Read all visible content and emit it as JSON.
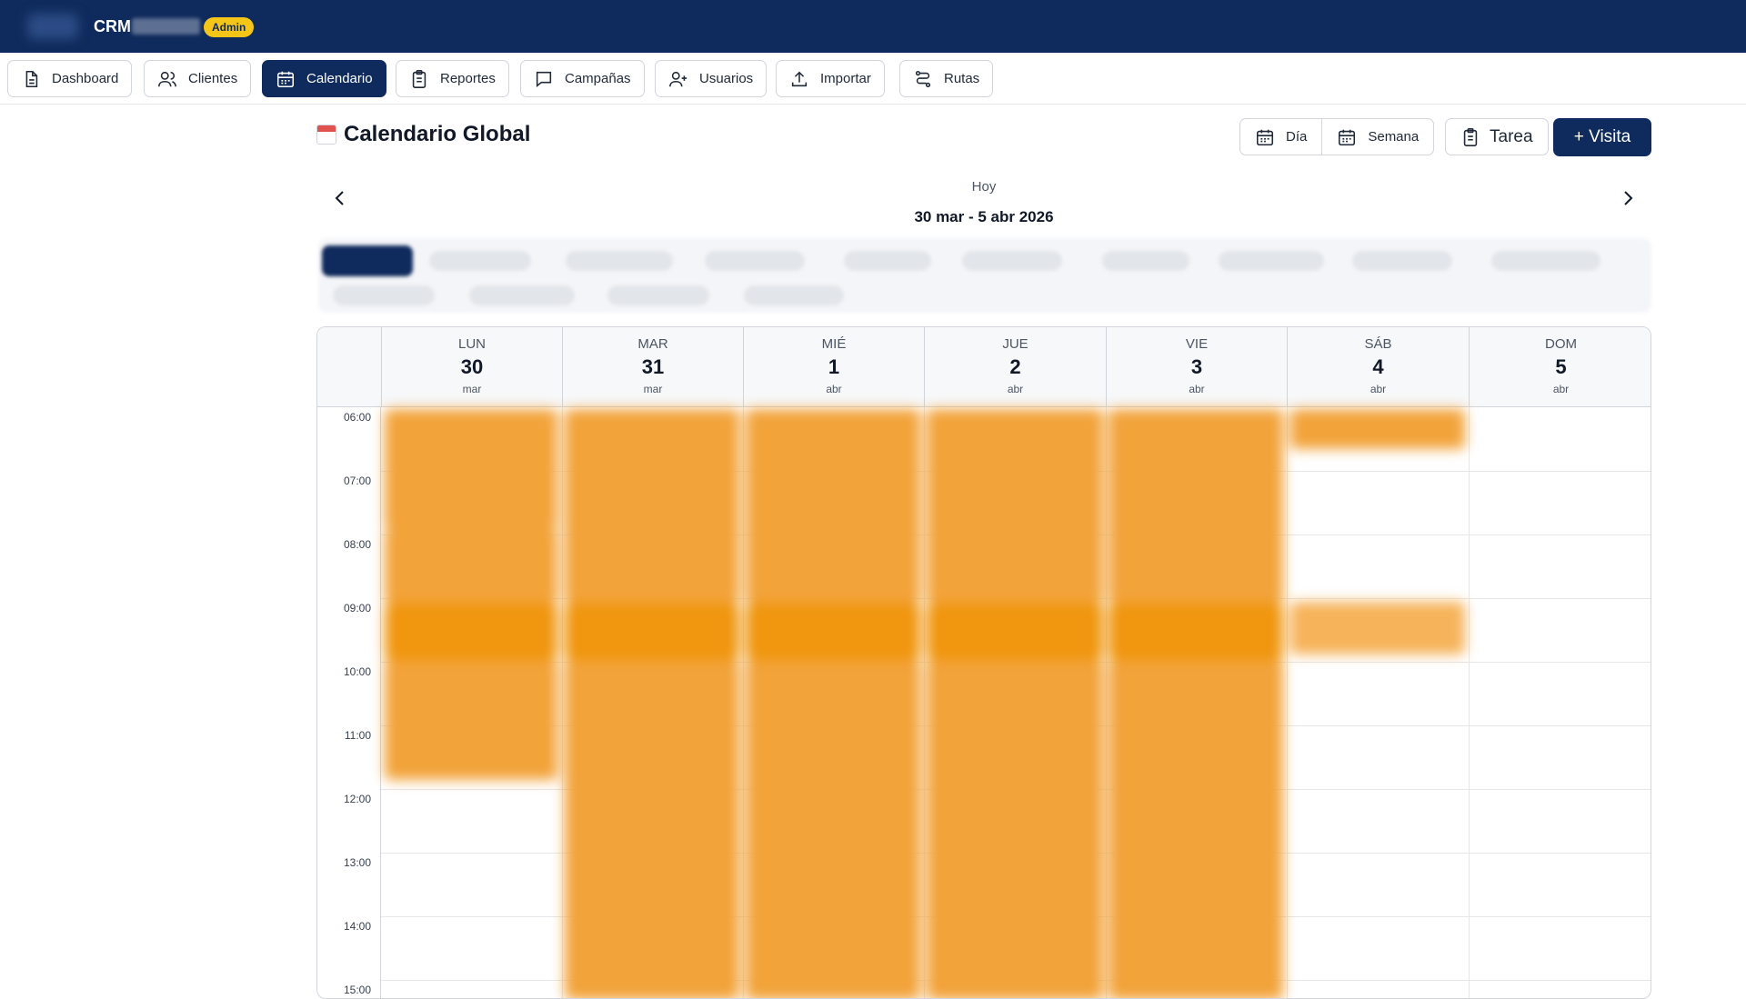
{
  "header": {
    "app_name": "CRM",
    "role_badge": "Admin",
    "colors": {
      "primary": "#0f2a5c",
      "badge": "#f5c518",
      "event": "#f2a33a"
    }
  },
  "nav": {
    "tabs": [
      {
        "label": "Dashboard",
        "icon": "document-icon",
        "active": false
      },
      {
        "label": "Clientes",
        "icon": "users-icon",
        "active": false
      },
      {
        "label": "Calendario",
        "icon": "calendar-icon",
        "active": true
      },
      {
        "label": "Reportes",
        "icon": "clipboard-icon",
        "active": false
      },
      {
        "label": "Campañas",
        "icon": "chat-icon",
        "active": false
      },
      {
        "label": "Usuarios",
        "icon": "user-plus-icon",
        "active": false
      },
      {
        "label": "Importar",
        "icon": "upload-icon",
        "active": false
      },
      {
        "label": "Rutas",
        "icon": "route-icon",
        "active": false
      }
    ]
  },
  "page": {
    "title": "Calendario Global",
    "view_buttons": {
      "day": "Día",
      "week": "Semana"
    },
    "task_button": "Tarea",
    "visit_button": "+ Visita",
    "today_label": "Hoy",
    "date_range": "30 mar - 5 abr 2026"
  },
  "calendar": {
    "days": [
      {
        "dow": "LUN",
        "num": "30",
        "month": "mar"
      },
      {
        "dow": "MAR",
        "num": "31",
        "month": "mar"
      },
      {
        "dow": "MIÉ",
        "num": "1",
        "month": "abr"
      },
      {
        "dow": "JUE",
        "num": "2",
        "month": "abr"
      },
      {
        "dow": "VIE",
        "num": "3",
        "month": "abr"
      },
      {
        "dow": "SÁB",
        "num": "4",
        "month": "abr"
      },
      {
        "dow": "DOM",
        "num": "5",
        "month": "abr"
      }
    ],
    "hours": [
      "06:00",
      "07:00",
      "08:00",
      "09:00",
      "10:00",
      "11:00",
      "12:00",
      "13:00",
      "14:00",
      "15:00"
    ]
  }
}
